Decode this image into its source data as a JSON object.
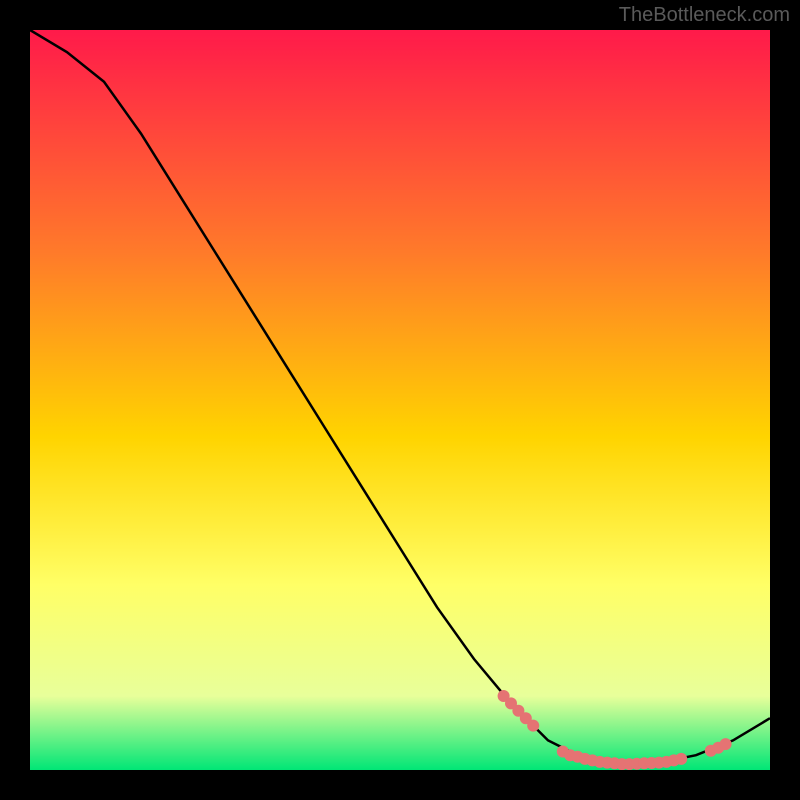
{
  "watermark": "TheBottleneck.com",
  "chart_data": {
    "type": "line",
    "title": "",
    "xlabel": "",
    "ylabel": "",
    "xlim": [
      0,
      100
    ],
    "ylim": [
      0,
      100
    ],
    "background_gradient": {
      "top": "#ff1a4a",
      "mid_upper": "#ff7a2a",
      "mid": "#ffd400",
      "mid_lower": "#ffff66",
      "lower": "#e8ff9a",
      "bottom": "#00e676"
    },
    "curve": [
      {
        "x": 0,
        "y": 100
      },
      {
        "x": 5,
        "y": 97
      },
      {
        "x": 10,
        "y": 93
      },
      {
        "x": 15,
        "y": 86
      },
      {
        "x": 20,
        "y": 78
      },
      {
        "x": 25,
        "y": 70
      },
      {
        "x": 30,
        "y": 62
      },
      {
        "x": 35,
        "y": 54
      },
      {
        "x": 40,
        "y": 46
      },
      {
        "x": 45,
        "y": 38
      },
      {
        "x": 50,
        "y": 30
      },
      {
        "x": 55,
        "y": 22
      },
      {
        "x": 60,
        "y": 15
      },
      {
        "x": 65,
        "y": 9
      },
      {
        "x": 70,
        "y": 4
      },
      {
        "x": 75,
        "y": 1.5
      },
      {
        "x": 80,
        "y": 0.8
      },
      {
        "x": 85,
        "y": 1
      },
      {
        "x": 90,
        "y": 2
      },
      {
        "x": 95,
        "y": 4
      },
      {
        "x": 100,
        "y": 7
      }
    ],
    "markers": [
      {
        "x": 64,
        "y": 10
      },
      {
        "x": 65,
        "y": 9
      },
      {
        "x": 66,
        "y": 8
      },
      {
        "x": 67,
        "y": 7
      },
      {
        "x": 68,
        "y": 6
      },
      {
        "x": 72,
        "y": 2.5
      },
      {
        "x": 73,
        "y": 2
      },
      {
        "x": 74,
        "y": 1.8
      },
      {
        "x": 75,
        "y": 1.5
      },
      {
        "x": 76,
        "y": 1.3
      },
      {
        "x": 77,
        "y": 1.1
      },
      {
        "x": 78,
        "y": 1
      },
      {
        "x": 79,
        "y": 0.9
      },
      {
        "x": 80,
        "y": 0.8
      },
      {
        "x": 81,
        "y": 0.8
      },
      {
        "x": 82,
        "y": 0.85
      },
      {
        "x": 83,
        "y": 0.9
      },
      {
        "x": 84,
        "y": 0.95
      },
      {
        "x": 85,
        "y": 1
      },
      {
        "x": 86,
        "y": 1.1
      },
      {
        "x": 87,
        "y": 1.3
      },
      {
        "x": 88,
        "y": 1.5
      },
      {
        "x": 92,
        "y": 2.6
      },
      {
        "x": 93,
        "y": 3
      },
      {
        "x": 94,
        "y": 3.5
      }
    ],
    "marker_color": "#e57373"
  }
}
